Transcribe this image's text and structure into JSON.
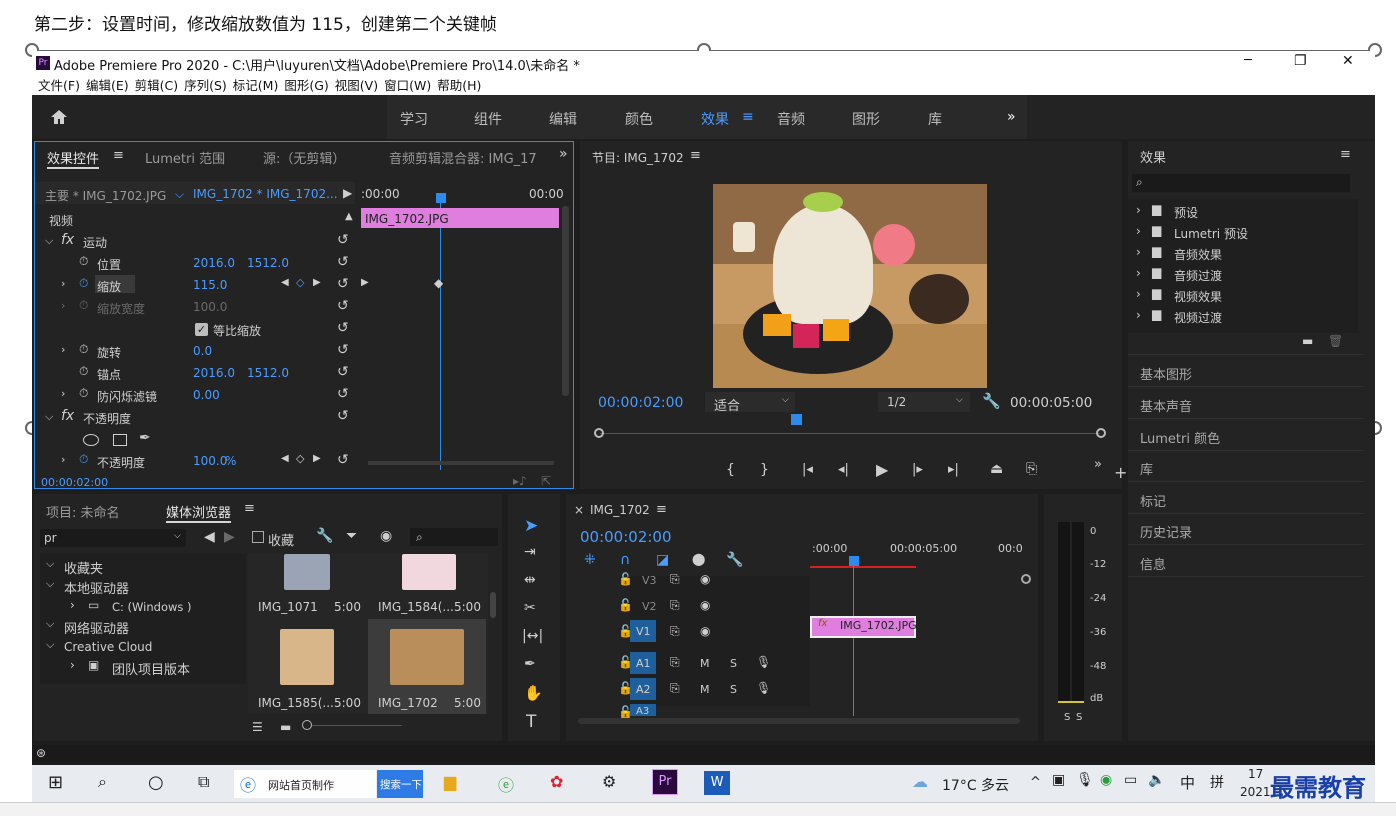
{
  "caption": "第二步：设置时间，修改缩放数值为 115，创建第二个关键帧",
  "window": {
    "title": "Adobe Premiere Pro 2020 - C:\\用户\\luyuren\\文档\\Adobe\\Premiere Pro\\14.0\\未命名 *",
    "app_icon": "Pr",
    "minimize": "─",
    "maximize": "❐",
    "close": "✕"
  },
  "menu": [
    "文件(F)",
    "编辑(E)",
    "剪辑(C)",
    "序列(S)",
    "标记(M)",
    "图形(G)",
    "视图(V)",
    "窗口(W)",
    "帮助(H)"
  ],
  "workspace": {
    "tabs": [
      "学习",
      "组件",
      "编辑",
      "颜色",
      "效果",
      "音频",
      "图形",
      "库"
    ],
    "active": "效果",
    "more": "»"
  },
  "effect_controls": {
    "tabs": [
      "效果控件",
      "Lumetri 范围",
      "源:（无剪辑）",
      "音频剪辑混合器: IMG_17"
    ],
    "master": "主要 * IMG_1702.JPG",
    "sequence_clip": "IMG_1702 * IMG_1702...",
    "time_start": ":00:00",
    "time_end": "00:00",
    "clip_bar": "IMG_1702.JPG",
    "video_label": "视频",
    "motion": "运动",
    "position": "位置",
    "pos_x": "2016.0",
    "pos_y": "1512.0",
    "scale": "缩放",
    "scale_val": "115.0",
    "scale_width": "缩放宽度",
    "scale_width_val": "100.0",
    "uniform": "等比缩放",
    "rotation": "旋转",
    "rotation_val": "0.0",
    "anchor": "锚点",
    "anchor_x": "2016.0",
    "anchor_y": "1512.0",
    "flicker": "防闪烁滤镜",
    "flicker_val": "0.00",
    "opacity_group": "不透明度",
    "opacity": "不透明度",
    "opacity_val": "100.0",
    "opacity_unit": "%",
    "current_time": "00:00:02:00"
  },
  "program": {
    "title": "节目: IMG_1702",
    "timecode": "00:00:02:00",
    "fit": "适合",
    "quality": "1/2",
    "duration": "00:00:05:00"
  },
  "effects_panel": {
    "title": "效果",
    "items": [
      "预设",
      "Lumetri 预设",
      "音频效果",
      "音频过渡",
      "视频效果",
      "视频过渡"
    ],
    "sections": [
      "基本图形",
      "基本声音",
      "Lumetri 颜色",
      "库",
      "标记",
      "历史记录",
      "信息"
    ]
  },
  "project": {
    "tab1": "项目: 未命名",
    "tab2": "媒体浏览器",
    "collect": "收藏",
    "search_value": "pr",
    "tree": [
      "收藏夹",
      "本地驱动器",
      "C: (Windows )",
      "网络驱动器",
      "Creative Cloud",
      "团队项目版本"
    ],
    "thumbs": [
      {
        "name": "IMG_1071",
        "dur": "5:00"
      },
      {
        "name": "IMG_1584(...",
        "dur": "5:00"
      },
      {
        "name": "IMG_1585(...",
        "dur": "5:00"
      },
      {
        "name": "IMG_1702",
        "dur": "5:00"
      }
    ]
  },
  "timeline": {
    "title": "IMG_1702",
    "timecode": "00:00:02:00",
    "ruler": [
      ":00:00",
      "00:00:05:00",
      "00:0"
    ],
    "tracks": [
      "V3",
      "V2",
      "V1",
      "A1",
      "A2",
      "A3"
    ],
    "clip": "IMG_1702.JPG",
    "m": "M",
    "s": "S"
  },
  "meter": {
    "ticks": [
      "0",
      "-12",
      "-24",
      "-36",
      "-48",
      "dB"
    ],
    "solo": "S"
  },
  "taskbar": {
    "browser": "网站首页制作",
    "search": "搜索一下",
    "weather": "17°C 多云",
    "ime": "中",
    "ime2": "拼",
    "time": "17",
    "date": "2021",
    "watermark": "最需教育"
  }
}
